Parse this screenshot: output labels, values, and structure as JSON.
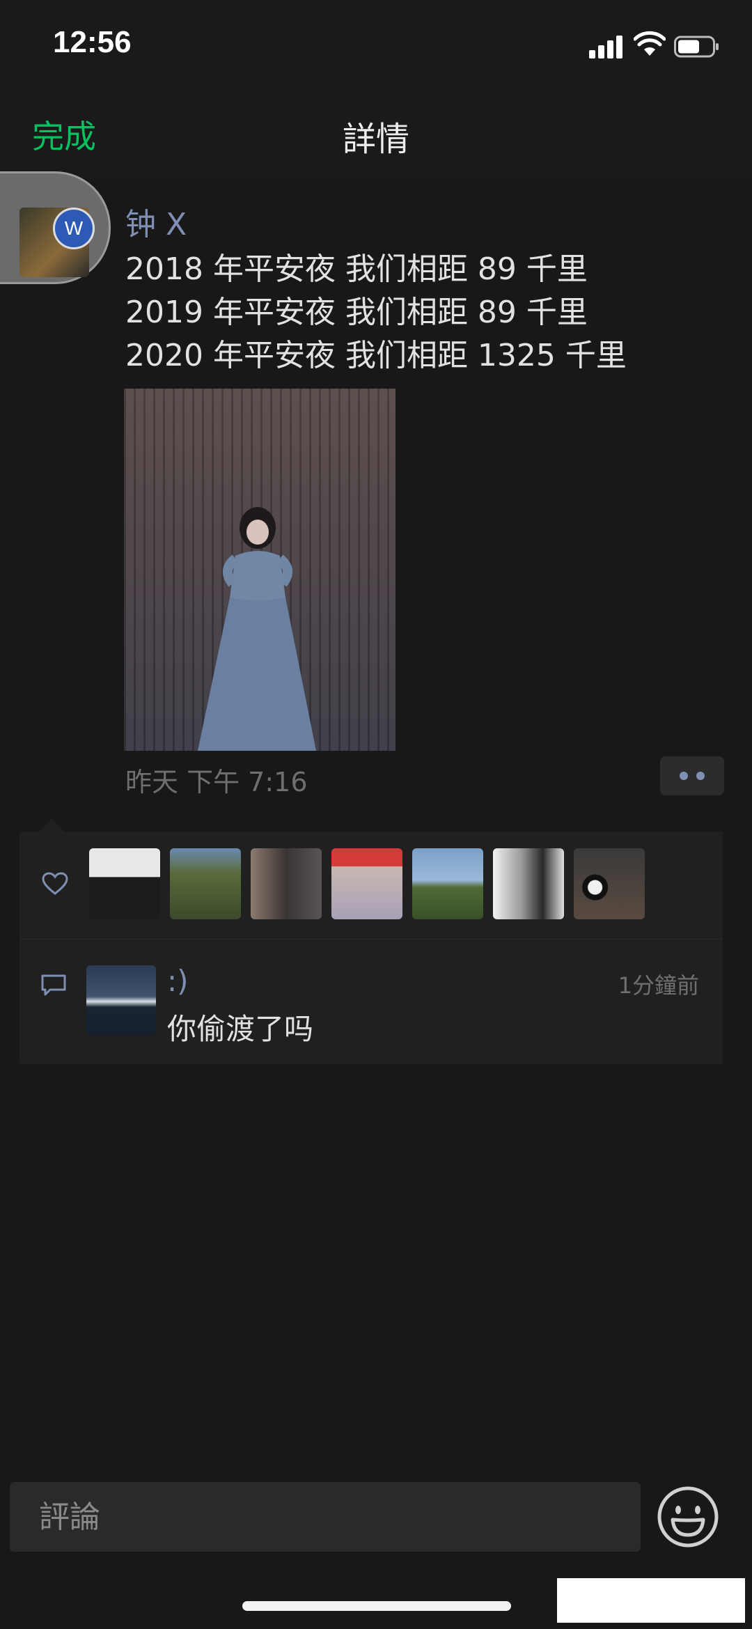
{
  "status_bar": {
    "time": "12:56"
  },
  "nav": {
    "done_label": "完成",
    "title": "詳情"
  },
  "post": {
    "author": "钟 X",
    "avatar_badge": "W",
    "lines": [
      "2018 年平安夜 我们相距 89 千里",
      "2019 年平安夜 我们相距 89 千里",
      "2020 年平安夜 我们相距 1325 千里"
    ],
    "time": "昨天 下午 7:16"
  },
  "likes": {
    "avatars": [
      {
        "name": "like-avatar-1",
        "colors": [
          "#e8e8e8",
          "#1c1c1c"
        ]
      },
      {
        "name": "like-avatar-2",
        "colors": [
          "#5a6b3a",
          "#3b4a2a"
        ]
      },
      {
        "name": "like-avatar-3",
        "colors": [
          "#8c7b6e",
          "#3a3434"
        ]
      },
      {
        "name": "like-avatar-4",
        "colors": [
          "#d33a3a",
          "#c8b8b0"
        ]
      },
      {
        "name": "like-avatar-5",
        "colors": [
          "#7aa0c8",
          "#4f6a35"
        ]
      },
      {
        "name": "like-avatar-6",
        "colors": [
          "#f2f2f2",
          "#2a2a2a"
        ]
      },
      {
        "name": "like-avatar-7",
        "colors": [
          "#3a3a3a",
          "#5a4a40"
        ]
      }
    ]
  },
  "comment": {
    "author": ":)",
    "time": "1分鐘前",
    "text": "你偷渡了吗"
  },
  "input": {
    "placeholder": "評論"
  }
}
